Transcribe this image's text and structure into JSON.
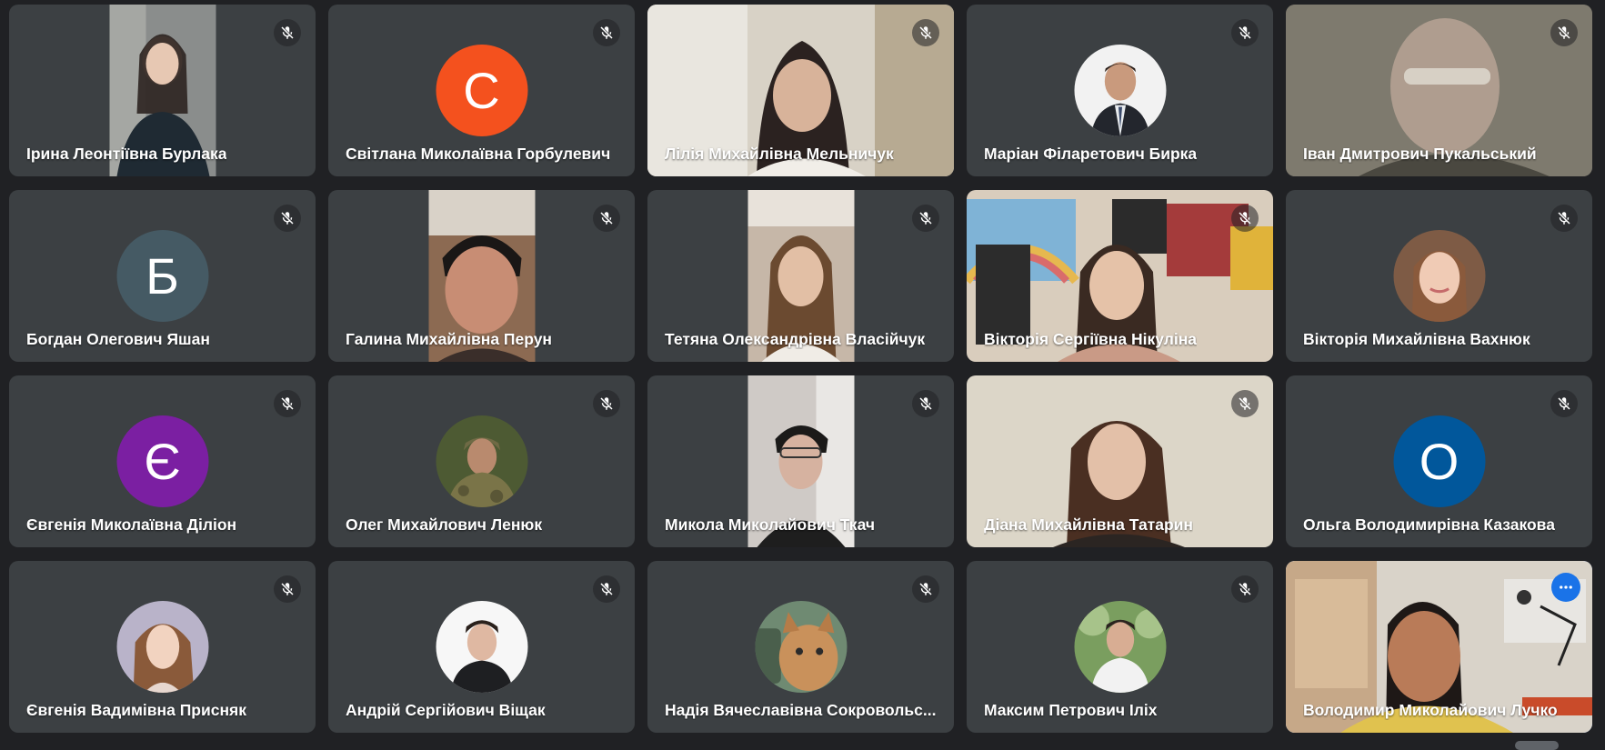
{
  "meeting": {
    "participants": [
      {
        "name": "Ірина Леонтіївна Бурлака"
      },
      {
        "name": "Світлана Миколаївна Горбулевич",
        "initial": "С",
        "avatar_color": "#f4511e"
      },
      {
        "name": "Лілія Михайлівна Мельничук"
      },
      {
        "name": "Маріан Філаретович Бирка"
      },
      {
        "name": "Іван Дмитрович Пукальський"
      },
      {
        "name": "Богдан Олегович Яшан",
        "initial": "Б",
        "avatar_color": "#455a64"
      },
      {
        "name": "Галина Михайлівна Перун"
      },
      {
        "name": "Тетяна Олександрівна Власійчук"
      },
      {
        "name": "Вікторія Сергіївна Нікуліна"
      },
      {
        "name": "Вікторія Михайлівна Вахнюк"
      },
      {
        "name": "Євгенія Миколаївна Діліон",
        "initial": "Є",
        "avatar_color": "#7b1fa2"
      },
      {
        "name": "Олег Михайлович Ленюк"
      },
      {
        "name": "Микола Миколайович Ткач"
      },
      {
        "name": "Діана Михайлівна Татарин"
      },
      {
        "name": "Ольга Володимирівна Казакова",
        "initial": "О",
        "avatar_color": "#01579b"
      },
      {
        "name": "Євгенія Вадимівна Присняк"
      },
      {
        "name": "Андрій Сергійович Віщак"
      },
      {
        "name": "Надія Вячеславівна Сокровольс..."
      },
      {
        "name": "Максим Петрович Іліх"
      },
      {
        "name": "Володимир Миколайович Лучко"
      }
    ],
    "icons": {
      "mute": "mic-off-icon",
      "more": "more-options-icon"
    },
    "colors": {
      "background": "#202124",
      "tile": "#3c4043",
      "active_border": "#8ab4f8",
      "more_button": "#1a73e8"
    }
  }
}
